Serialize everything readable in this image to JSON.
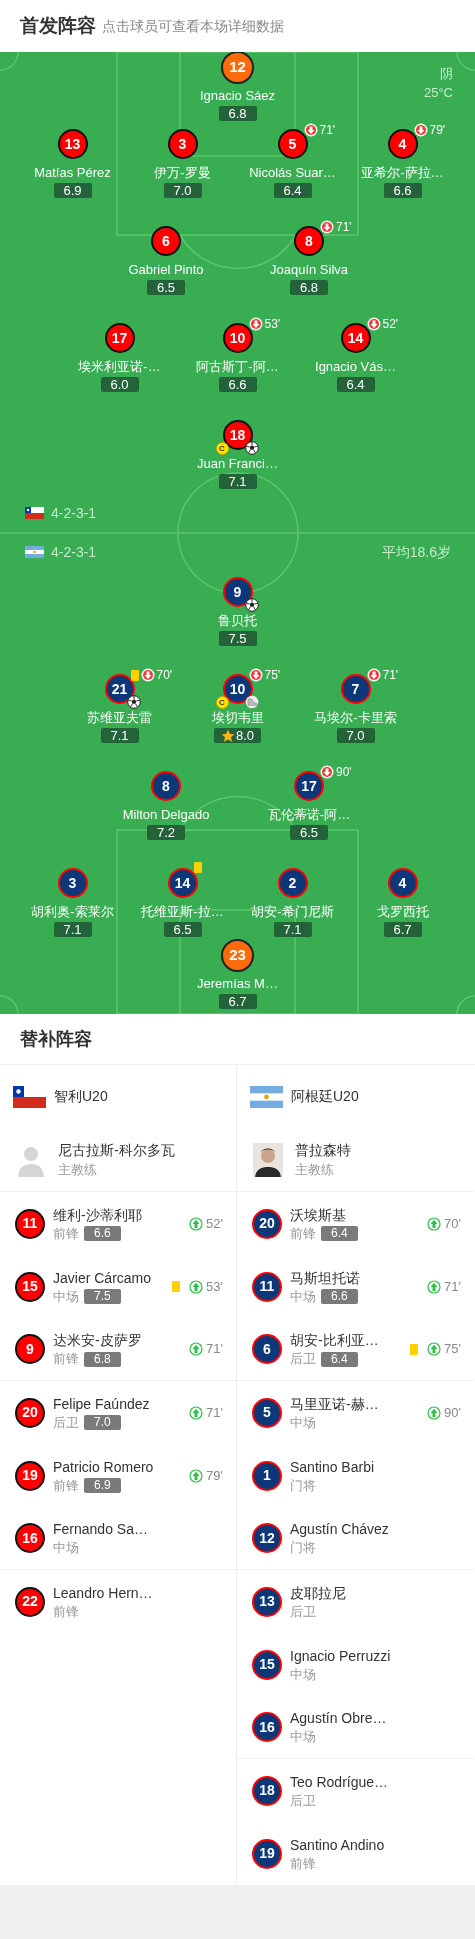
{
  "header": {
    "title": "首发阵容",
    "hint": "点击球员可查看本场详细数据"
  },
  "pitch": {
    "weather": "阴",
    "temperature": "25°C",
    "average_age": "平均18.6岁",
    "teams": [
      {
        "kind": "chile",
        "formation": "4-2-3-1",
        "lines": [
          {
            "kind": "goalkeeper",
            "players": [
              {
                "number": "12",
                "name": "Ignacio Sáez",
                "rating": "6.8",
                "best": false
              }
            ]
          },
          {
            "kind": "outfield",
            "players": [
              {
                "number": "13",
                "name": "Matías Pérez",
                "rating": "6.9",
                "best": false
              },
              {
                "number": "3",
                "name": "伊万-罗曼",
                "rating": "7.0",
                "best": false
              },
              {
                "number": "5",
                "name": "Nicolás Suar…",
                "rating": "6.4",
                "best": false,
                "events": [
                  {
                    "kind": "sub_off",
                    "minute": "71'"
                  }
                ]
              },
              {
                "number": "4",
                "name": "亚希尔-萨拉…",
                "rating": "6.6",
                "best": false,
                "events": [
                  {
                    "kind": "sub_off",
                    "minute": "79'"
                  }
                ]
              }
            ]
          },
          {
            "kind": "outfield",
            "players": [
              {
                "number": "6",
                "name": "Gabriel Pinto",
                "rating": "6.5",
                "best": false
              },
              {
                "number": "8",
                "name": "Joaquín Silva",
                "rating": "6.8",
                "best": false,
                "events": [
                  {
                    "kind": "sub_off",
                    "minute": "71'"
                  }
                ]
              }
            ]
          },
          {
            "kind": "outfield",
            "players": [
              {
                "number": "17",
                "name": "埃米利亚诺-…",
                "rating": "6.0",
                "best": false
              },
              {
                "number": "10",
                "name": "阿古斯丁-阿…",
                "rating": "6.6",
                "best": false,
                "events": [
                  {
                    "kind": "sub_off",
                    "minute": "53'"
                  }
                ]
              },
              {
                "number": "14",
                "name": "Ignacio Vás…",
                "rating": "6.4",
                "best": false,
                "events": [
                  {
                    "kind": "sub_off",
                    "minute": "52'"
                  }
                ]
              }
            ]
          },
          {
            "kind": "outfield",
            "players": [
              {
                "number": "18",
                "name": "Juan Franci…",
                "rating": "7.1",
                "best": false,
                "events": [
                  {
                    "kind": "captain",
                    "label": "C"
                  },
                  {
                    "kind": "goal"
                  }
                ]
              }
            ]
          }
        ]
      },
      {
        "kind": "argentina",
        "formation": "4-2-3-1",
        "lines": [
          {
            "kind": "outfield",
            "players": [
              {
                "number": "9",
                "name": "鲁贝托",
                "rating": "7.5",
                "best": false,
                "events": [
                  {
                    "kind": "goal"
                  }
                ]
              }
            ]
          },
          {
            "kind": "outfield",
            "players": [
              {
                "number": "21",
                "name": "苏维亚夫雷",
                "rating": "7.1",
                "best": false,
                "events": [
                  {
                    "kind": "yellow_card"
                  },
                  {
                    "kind": "sub_off",
                    "minute": "70'"
                  },
                  {
                    "kind": "goal"
                  }
                ]
              },
              {
                "number": "10",
                "name": "埃切韦里",
                "rating": "8.0",
                "best": true,
                "events": [
                  {
                    "kind": "sub_off",
                    "minute": "75'"
                  },
                  {
                    "kind": "captain",
                    "label": "C"
                  },
                  {
                    "kind": "assist"
                  }
                ]
              },
              {
                "number": "7",
                "name": "马埃尔-卡里索",
                "rating": "7.0",
                "best": false,
                "events": [
                  {
                    "kind": "sub_off",
                    "minute": "71'"
                  }
                ]
              }
            ]
          },
          {
            "kind": "outfield",
            "players": [
              {
                "number": "8",
                "name": "Milton Delgado",
                "rating": "7.2",
                "best": false
              },
              {
                "number": "17",
                "name": "瓦伦蒂诺-阿…",
                "rating": "6.5",
                "best": false,
                "events": [
                  {
                    "kind": "sub_off",
                    "minute": "90'"
                  }
                ]
              }
            ]
          },
          {
            "kind": "outfield",
            "players": [
              {
                "number": "3",
                "name": "胡利奥-索莱尔",
                "rating": "7.1",
                "best": false
              },
              {
                "number": "14",
                "name": "托维亚斯-拉…",
                "rating": "6.5",
                "best": false,
                "events": [
                  {
                    "kind": "yellow_card"
                  }
                ]
              },
              {
                "number": "2",
                "name": "胡安-希门尼斯",
                "rating": "7.1",
                "best": false
              },
              {
                "number": "4",
                "name": "戈罗西托",
                "rating": "6.7",
                "best": false
              }
            ]
          },
          {
            "kind": "goalkeeper",
            "players": [
              {
                "number": "23",
                "name": "Jeremías M…",
                "rating": "6.7",
                "best": false
              }
            ]
          }
        ]
      }
    ]
  },
  "substitutes": {
    "title": "替补阵容",
    "columns": [
      {
        "kind": "chile",
        "team": "智利U20",
        "coach": {
          "name": "尼古拉斯-科尔多瓦",
          "role": "主教练",
          "photo": false
        },
        "players": [
          {
            "number": "11",
            "name": "维利-沙蒂利耶",
            "position": "前锋",
            "rating": "6.6",
            "yellow_card": false,
            "sub_on": "52'"
          },
          {
            "number": "15",
            "name": "Javier Cárcamo",
            "position": "中场",
            "rating": "7.5",
            "yellow_card": true,
            "sub_on": "53'"
          },
          {
            "number": "9",
            "name": "达米安-皮萨罗",
            "position": "前锋",
            "rating": "6.8",
            "yellow_card": false,
            "sub_on": "71'"
          },
          {
            "number": "20",
            "name": "Felipe Faúndez",
            "position": "后卫",
            "rating": "7.0",
            "yellow_card": false,
            "sub_on": "71'"
          },
          {
            "number": "19",
            "name": "Patricio Romero",
            "position": "前锋",
            "rating": "6.9",
            "yellow_card": false,
            "sub_on": "79'"
          },
          {
            "number": "16",
            "name": "Fernando Sa…",
            "position": "中场",
            "yellow_card": false
          },
          {
            "number": "22",
            "name": "Leandro Hern…",
            "position": "前锋",
            "yellow_card": false
          }
        ]
      },
      {
        "kind": "argentina",
        "team": "阿根廷U20",
        "coach": {
          "name": "普拉森特",
          "role": "主教练",
          "photo": true
        },
        "players": [
          {
            "number": "20",
            "name": "沃埃斯基",
            "position": "前锋",
            "rating": "6.4",
            "yellow_card": false,
            "sub_on": "70'"
          },
          {
            "number": "11",
            "name": "马斯坦托诺",
            "position": "中场",
            "rating": "6.6",
            "yellow_card": false,
            "sub_on": "71'"
          },
          {
            "number": "6",
            "name": "胡安-比利亚…",
            "position": "后卫",
            "rating": "6.4",
            "yellow_card": true,
            "sub_on": "75'"
          },
          {
            "number": "5",
            "name": "马里亚诺-赫…",
            "position": "中场",
            "yellow_card": false,
            "sub_on": "90'"
          },
          {
            "number": "1",
            "name": "Santino Barbi",
            "position": "门将",
            "yellow_card": false
          },
          {
            "number": "12",
            "name": "Agustín Chávez",
            "position": "门将",
            "yellow_card": false
          },
          {
            "number": "13",
            "name": "皮耶拉尼",
            "position": "后卫",
            "yellow_card": false
          },
          {
            "number": "15",
            "name": "Ignacio Perruzzi",
            "position": "中场",
            "yellow_card": false
          },
          {
            "number": "16",
            "name": "Agustín Obre…",
            "position": "中场",
            "yellow_card": false
          },
          {
            "number": "18",
            "name": "Teo Rodrígue…",
            "position": "后卫",
            "yellow_card": false
          },
          {
            "number": "19",
            "name": "Santino Andino",
            "position": "前锋",
            "yellow_card": false
          }
        ]
      }
    ]
  }
}
